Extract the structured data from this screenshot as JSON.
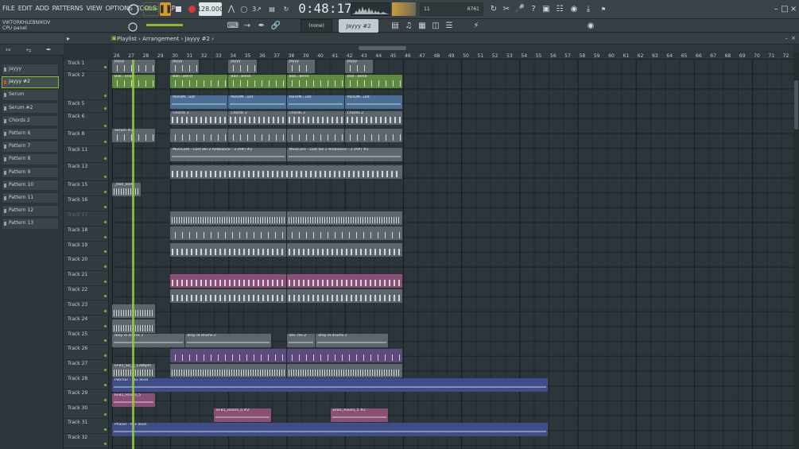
{
  "menu": [
    "FILE",
    "EDIT",
    "ADD",
    "PATTERNS",
    "VIEW",
    "OPTIONS",
    "TOOLS",
    "HELP"
  ],
  "transport": {
    "mode": "SONG",
    "tempo": "128.000",
    "time": "0:48:17",
    "pattern_select": "Jayyy #2",
    "snap": "(none)",
    "cpu": "11",
    "mem": "6761",
    "mem2": "62"
  },
  "user": {
    "name": "VIKTORKHLEBNIKOV",
    "hint": "CPU panel"
  },
  "breadcrumb": [
    "Playlist",
    "Arrangement",
    "Jayyy #2"
  ],
  "patterns": [
    {
      "label": "Jayyy"
    },
    {
      "label": "Jayyy #2",
      "selected": true
    },
    {
      "label": "Serum"
    },
    {
      "label": "Serum #2"
    },
    {
      "label": "Chords 2"
    },
    {
      "label": "Pattern 6"
    },
    {
      "label": "Pattern 7"
    },
    {
      "label": "Pattern 8"
    },
    {
      "label": "Pattern 9"
    },
    {
      "label": "Pattern 10"
    },
    {
      "label": "Pattern 11"
    },
    {
      "label": "Pattern 12"
    },
    {
      "label": "Pattern 13"
    }
  ],
  "ruler": {
    "first": 26,
    "last": 73
  },
  "tracks": [
    "Track 1",
    "Track 2",
    "",
    "",
    "Track 5",
    "Track 6",
    "",
    "Track 8",
    "",
    "",
    "Track 11",
    "",
    "Track 13",
    "",
    "Track 15",
    "Track 16",
    "Track 17",
    "",
    "Track 18",
    "Track 19",
    "Track 20",
    "Track 21",
    "Track 22",
    "Track 23",
    "Track 24",
    "Track 25",
    "Track 26",
    "Track 27",
    "Track 28",
    "Track 29",
    "Track 30",
    "Track 31",
    "Track 32"
  ],
  "colors": {
    "bg": "#2a3338",
    "accent": "#95cc3a",
    "clip_green": "#5d8a3e",
    "clip_blue": "#4a6f95",
    "clip_grey": "#5c666b",
    "clip_violet": "#5b4b7d",
    "clip_pink": "#8a4f75",
    "clip_navy": "#3f4d88"
  }
}
